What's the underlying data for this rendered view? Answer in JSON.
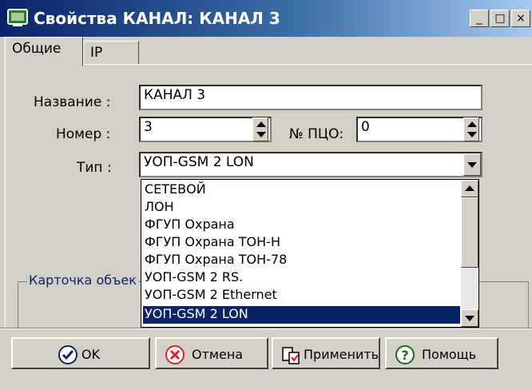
{
  "window": {
    "title": "Свойства КАНАЛ: КАНАЛ 3",
    "controls": {
      "minimize": "_",
      "maximize": "□",
      "close": "×"
    }
  },
  "tabs": [
    {
      "label": "Общие",
      "active": true
    },
    {
      "label": "IP",
      "active": false
    }
  ],
  "form": {
    "name_label": "Название :",
    "name_value": "КАНАЛ 3",
    "number_label": "Номер :",
    "number_value": "3",
    "pco_label": "№ ПЦО:",
    "pco_value": "0",
    "type_label": "Тип :",
    "type_value": "УОП-GSM 2 LON"
  },
  "dropdown": {
    "options": [
      "СЕТЕВОЙ",
      "ЛОН",
      "ФГУП Охрана",
      "ФГУП Охрана ТОН-Н",
      "ФГУП Охрана ТОН-78",
      "УОП-GSM 2 RS.",
      "УОП-GSM 2 Ethernet",
      "УОП-GSM 2 LON"
    ],
    "selected_index": 7
  },
  "groupbox": {
    "label": "Карточка объек"
  },
  "buttons": {
    "ok": "OK",
    "cancel": "Отмена",
    "apply": "Применить",
    "help": "Помощь"
  },
  "icons": {
    "title": "window-app-icon",
    "ok": "check-circle-icon",
    "cancel": "x-circle-icon",
    "apply": "apply-document-icon",
    "help": "question-circle-icon"
  },
  "colors": {
    "title_bar": "#0a246a",
    "window_face": "#d4d0c8",
    "selection": "#0a246a",
    "cancel_icon": "#e02020",
    "ok_icon": "#0a246a",
    "help_icon": "#1a6e1a"
  }
}
